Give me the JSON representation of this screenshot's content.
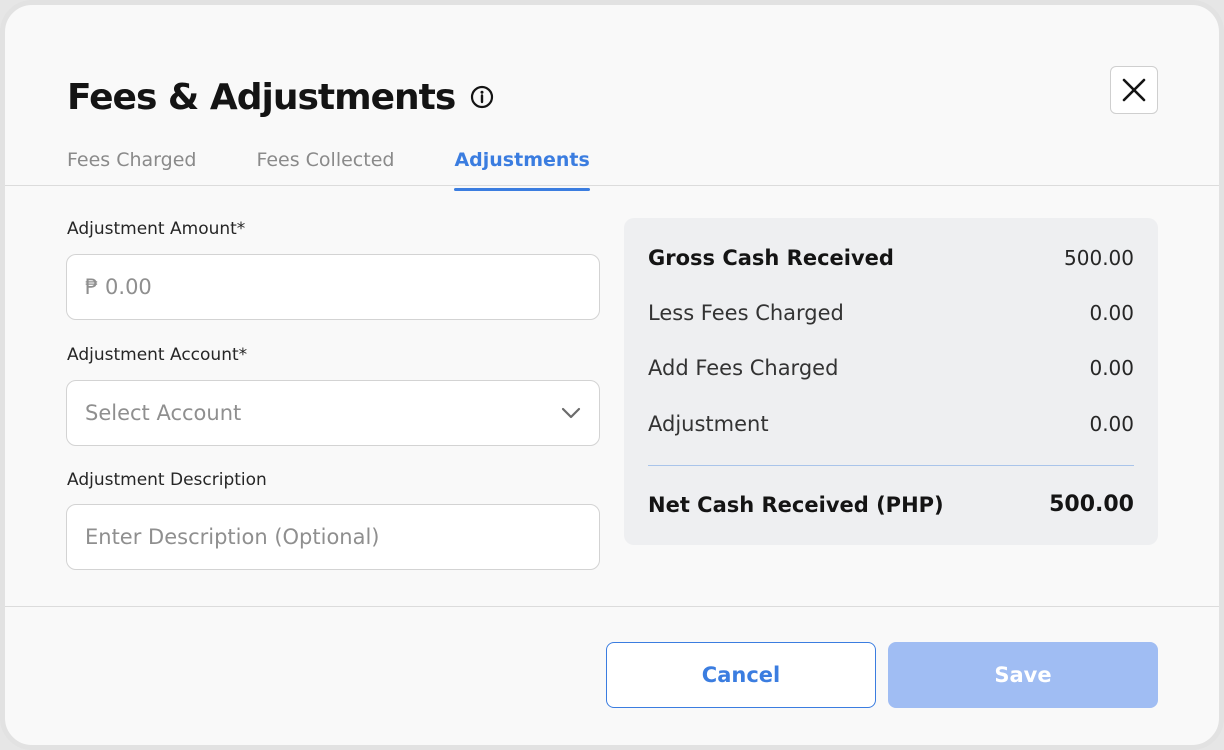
{
  "dialog": {
    "title": "Fees & Adjustments",
    "close_icon": "close-icon",
    "info_icon": "info-icon"
  },
  "tabs": [
    {
      "label": "Fees Charged",
      "active": false
    },
    {
      "label": "Fees Collected",
      "active": false
    },
    {
      "label": "Adjustments",
      "active": true
    }
  ],
  "form": {
    "amount": {
      "label": "Adjustment Amount*",
      "placeholder": "₱ 0.00",
      "value": ""
    },
    "account": {
      "label": "Adjustment Account*",
      "placeholder": "Select Account",
      "icon": "chevron-down-icon"
    },
    "description": {
      "label": "Adjustment Description",
      "placeholder": "Enter Description (Optional)",
      "value": ""
    }
  },
  "summary": {
    "rows": [
      {
        "label": "Gross Cash Received",
        "value": "500.00"
      },
      {
        "label": "Less Fees Charged",
        "value": "0.00"
      },
      {
        "label": "Add Fees Charged",
        "value": "0.00"
      },
      {
        "label": "Adjustment",
        "value": "0.00"
      }
    ],
    "net": {
      "label": "Net Cash Received (PHP)",
      "value": "500.00"
    }
  },
  "actions": {
    "cancel_label": "Cancel",
    "save_label": "Save"
  },
  "colors": {
    "accent": "#3b7de0",
    "save_disabled": "#a0bdf3",
    "summary_bg": "#eeeff1"
  }
}
